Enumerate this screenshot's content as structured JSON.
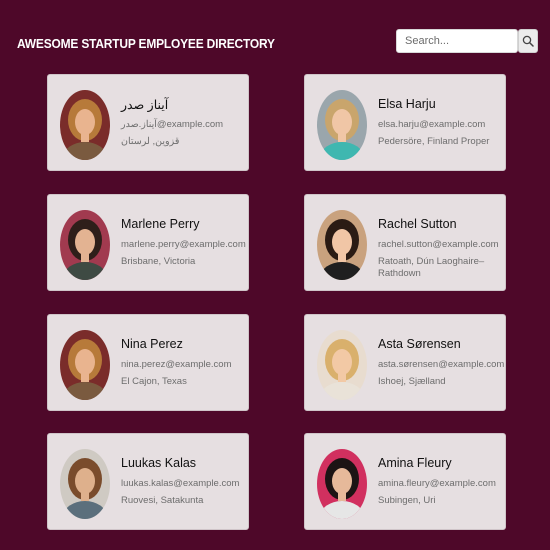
{
  "header": {
    "title": "AWESOME STARTUP EMPLOYEE DIRECTORY"
  },
  "search": {
    "placeholder": "Search...",
    "button_icon": "search-icon"
  },
  "employees": [
    {
      "name": "آیناز صدر",
      "email": "آیناز.صدر@example.com",
      "location": "قزوین, لرستان",
      "avatar_colors": {
        "bg": "#7a2c2a",
        "hair": "#b77a3a",
        "skin": "#e9b48f",
        "shirt": "#7a5a3f"
      }
    },
    {
      "name": "Elsa Harju",
      "email": "elsa.harju@example.com",
      "location": "Pedersöre, Finland Proper",
      "avatar_colors": {
        "bg": "#9aa6ac",
        "hair": "#c9a56c",
        "skin": "#f0c6a6",
        "shirt": "#3fb7b0"
      }
    },
    {
      "name": "Marlene Perry",
      "email": "marlene.perry@example.com",
      "location": "Brisbane, Victoria",
      "avatar_colors": {
        "bg": "#a13a4f",
        "hair": "#2e1f1a",
        "skin": "#e3b392",
        "shirt": "#3e4a43"
      }
    },
    {
      "name": "Rachel Sutton",
      "email": "rachel.sutton@example.com",
      "location": "Ratoath, Dún Laoghaire–Rathdown",
      "avatar_colors": {
        "bg": "#c9a27e",
        "hair": "#2a1b14",
        "skin": "#f1c6a6",
        "shirt": "#1f1f1f"
      }
    },
    {
      "name": "Nina Perez",
      "email": "nina.perez@example.com",
      "location": "El Cajon, Texas",
      "avatar_colors": {
        "bg": "#7a2c2a",
        "hair": "#b77a3a",
        "skin": "#e9b48f",
        "shirt": "#7a5a3f"
      }
    },
    {
      "name": "Asta Sørensen",
      "email": "asta.sørensen@example.com",
      "location": "Ishoej, Sjælland",
      "avatar_colors": {
        "bg": "#e8dccf",
        "hair": "#d9b06c",
        "skin": "#f2c9a5",
        "shirt": "#e9e2d8"
      }
    },
    {
      "name": "Luukas Kalas",
      "email": "luukas.kalas@example.com",
      "location": "Ruovesi, Satakunta",
      "avatar_colors": {
        "bg": "#cfcac3",
        "hair": "#7a4c2c",
        "skin": "#deb08c",
        "shirt": "#5b6f7c"
      }
    },
    {
      "name": "Amina Fleury",
      "email": "amina.fleury@example.com",
      "location": "Subingen, Uri",
      "avatar_colors": {
        "bg": "#d1305f",
        "hair": "#1c1414",
        "skin": "#e6b99a",
        "shirt": "#e6e6e6"
      }
    }
  ],
  "colors": {
    "background": "#4e0829",
    "card": "#e6dfe1",
    "title": "#ffffff"
  }
}
